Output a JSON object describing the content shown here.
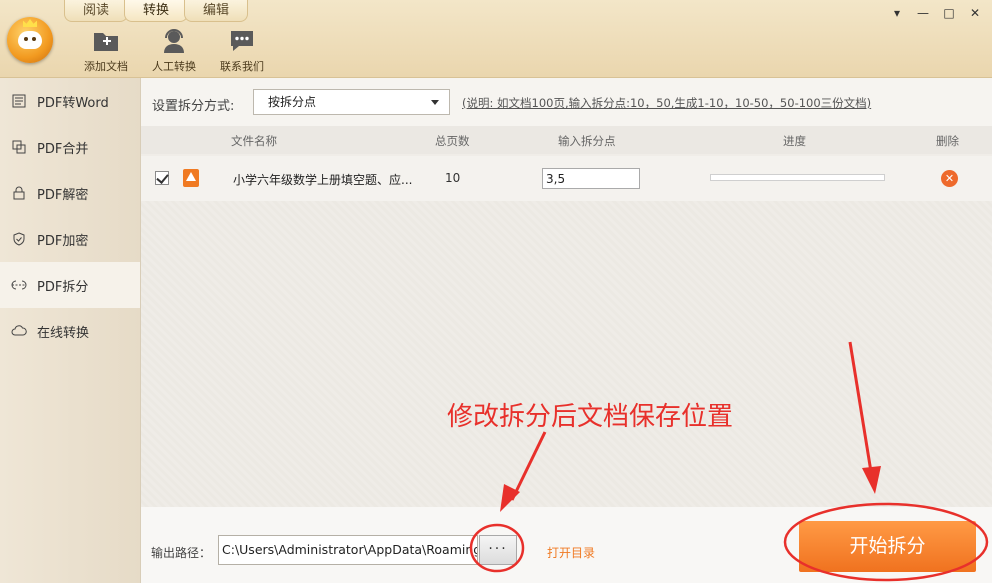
{
  "tabs": [
    "阅读",
    "转换",
    "编辑"
  ],
  "active_tab": 1,
  "tools": [
    {
      "label": "添加文档",
      "icon": "add-folder-icon"
    },
    {
      "label": "人工转换",
      "icon": "support-agent-icon"
    },
    {
      "label": "联系我们",
      "icon": "chat-bubble-icon"
    }
  ],
  "window_controls": [
    "▾",
    "—",
    "□",
    "✕"
  ],
  "sidebar": {
    "items": [
      {
        "label": "PDF转Word",
        "icon": "word-doc-icon"
      },
      {
        "label": "PDF合并",
        "icon": "merge-icon"
      },
      {
        "label": "PDF解密",
        "icon": "unlock-icon"
      },
      {
        "label": "PDF加密",
        "icon": "shield-icon"
      },
      {
        "label": "PDF拆分",
        "icon": "split-icon"
      },
      {
        "label": "在线转换",
        "icon": "cloud-icon"
      }
    ],
    "active": 4
  },
  "split_mode": {
    "label": "设置拆分方式:",
    "selected": "按拆分点",
    "hint": "(说明: 如文档100页,输入拆分点:10，50,生成1-10，10-50，50-100三份文档)"
  },
  "table": {
    "headers": {
      "name": "文件名称",
      "pages": "总页数",
      "split": "输入拆分点",
      "progress": "进度",
      "delete": "删除"
    },
    "rows": [
      {
        "checked": true,
        "name": "小学六年级数学上册填空题、应...",
        "pages": "10",
        "split_points": "3,5",
        "progress": 0
      }
    ]
  },
  "annotation": "修改拆分后文档保存位置",
  "output": {
    "label": "输出路径：",
    "path": "C:\\Users\\Administrator\\AppData\\Roaming",
    "browse_label": "···",
    "open_dir_label": "打开目录"
  },
  "start_label": "开始拆分",
  "colors": {
    "accent": "#f0721f",
    "annotation": "#e8302b",
    "topbar": "#ead6ae"
  }
}
